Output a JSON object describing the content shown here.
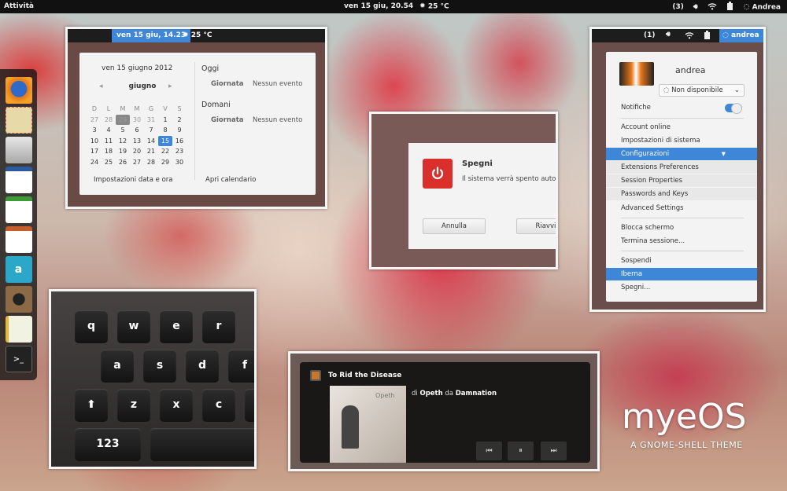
{
  "topbar": {
    "activities": "Attività",
    "datetime": "ven 15 giu, 20.54",
    "weather": "25 °C",
    "badge": "(3)",
    "user": "Andrea"
  },
  "calendar": {
    "panel_date": "ven 15 giu, 14.23",
    "panel_weather": "25 °C",
    "full_date": "ven 15 giugno 2012",
    "month": "giugno",
    "weekdays": [
      "D",
      "L",
      "M",
      "M",
      "G",
      "V",
      "S"
    ],
    "weeks": [
      [
        "27",
        "28",
        "29",
        "30",
        "31",
        "1",
        "2"
      ],
      [
        "3",
        "4",
        "5",
        "6",
        "7",
        "8",
        "9"
      ],
      [
        "10",
        "11",
        "12",
        "13",
        "14",
        "15",
        "16"
      ],
      [
        "17",
        "18",
        "19",
        "20",
        "21",
        "22",
        "23"
      ],
      [
        "24",
        "25",
        "26",
        "27",
        "28",
        "29",
        "30"
      ]
    ],
    "today": "15",
    "selected": "29",
    "today_label": "Oggi",
    "tomorrow_label": "Domani",
    "event_day": "Giornata",
    "no_event": "Nessun evento",
    "settings_link": "Impostazioni data e ora",
    "open_link": "Apri calendario"
  },
  "power": {
    "title": "Spegni",
    "message": "Il sistema verrà spento autor",
    "cancel": "Annulla",
    "restart": "Riavvia"
  },
  "usermenu": {
    "badge": "(1)",
    "button": "andrea",
    "name": "andrea",
    "status": "Non disponibile",
    "notifications": "Notifiche",
    "items": [
      "Account online",
      "Impostazioni di sistema",
      "Configurazioni",
      "Extensions Preferences",
      "Session Properties",
      "Passwords and Keys",
      "Advanced Settings",
      "Blocca schermo",
      "Termina sessione...",
      "Sospendi",
      "Iberna",
      "Spegni..."
    ]
  },
  "keyboard": {
    "row1": [
      "q",
      "w",
      "e",
      "r"
    ],
    "row2": [
      "a",
      "s",
      "d",
      "f"
    ],
    "row3": [
      "⬆",
      "z",
      "x",
      "c"
    ],
    "num": "123"
  },
  "music": {
    "title": "To Rid the Disease",
    "by": "di",
    "artist": "Opeth",
    "from": "da",
    "album": "Damnation"
  },
  "brand": {
    "name": "myeOS",
    "tagline": "A GNOME-SHELL THEME"
  },
  "colors": {
    "accent": "#3d86d8",
    "power": "#d9302c"
  }
}
